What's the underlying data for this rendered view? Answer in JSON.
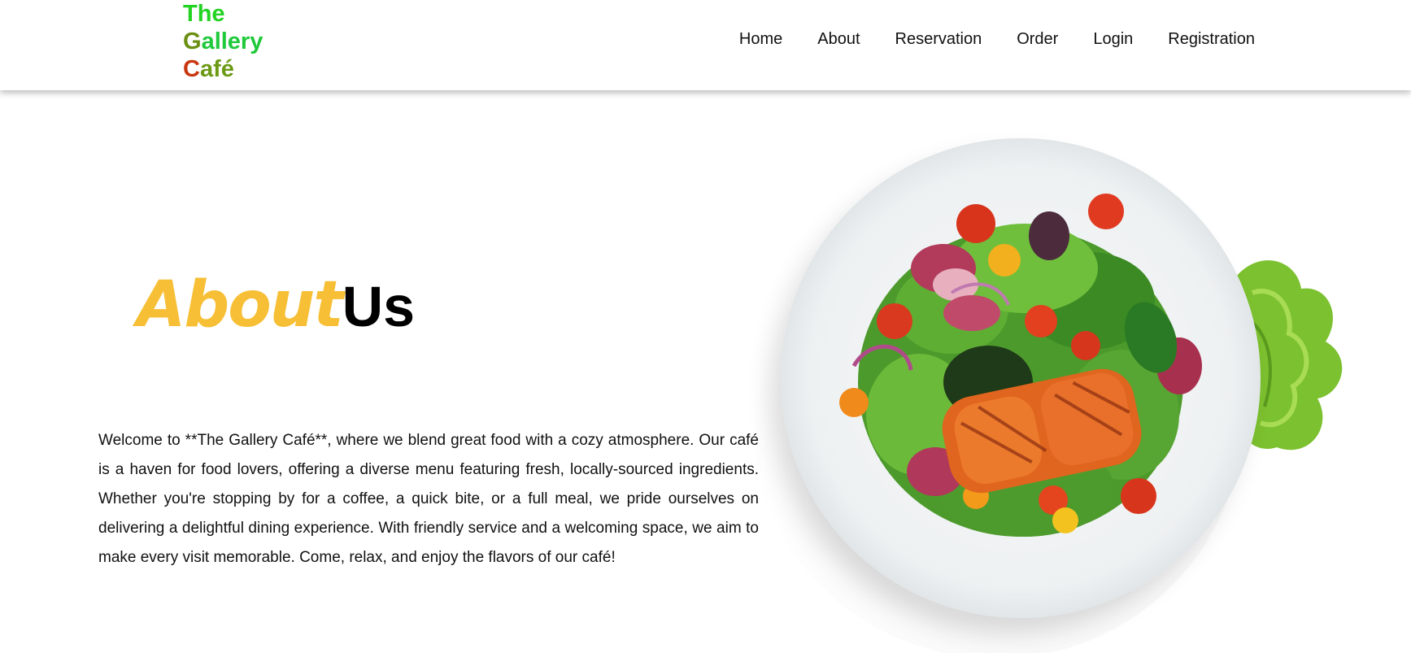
{
  "header": {
    "logo": {
      "line1": "The",
      "line2_first": "G",
      "line2_rest": "allery",
      "line3_first": "C",
      "line3_rest": "afé"
    },
    "nav": [
      "Home",
      "About",
      "Reservation",
      "Order",
      "Login",
      "Registration"
    ]
  },
  "main": {
    "heading_accent": "About",
    "heading_main": "Us",
    "intro": "Welcome to **The Gallery Café**, where we blend great food with a cozy atmosphere. Our café is a haven for food lovers, offering a diverse menu featuring fresh, locally-sourced ingredients. Whether you're stopping by for a coffee, a quick bite, or a full meal, we pride ourselves on delivering a delightful dining experience. With friendly service and a welcoming space, we aim to make every visit memorable. Come, relax, and enjoy the flavors of our café!",
    "image": "salmon-salad-plate"
  },
  "colors": {
    "accent": "#f7bf35",
    "logo_green": "#22d322",
    "logo_olive": "#6a8f12",
    "logo_red": "#c8370f"
  }
}
